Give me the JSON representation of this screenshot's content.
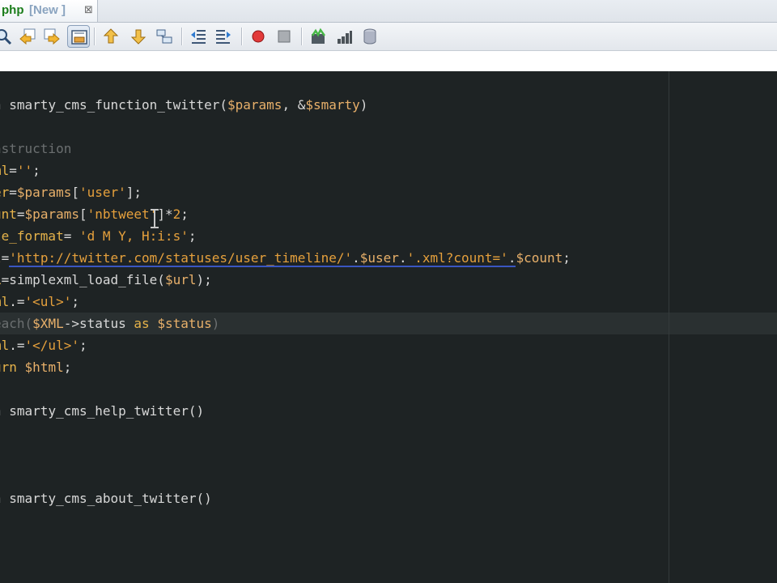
{
  "tab": {
    "file_label": "php",
    "status_badge": "[New ]",
    "close_glyph": "⊠"
  },
  "toolbar": {
    "icons": [
      "find-icon",
      "back-icon",
      "forward-icon",
      "toggle-view-icon",
      "up-icon",
      "down-icon",
      "breadcrumb-icon",
      "shift-left-icon",
      "shift-right-icon",
      "record-macro-icon",
      "stop-macro-icon",
      "bookmark-icon",
      "chart-icon",
      "database-icon"
    ],
    "active": "toggle-view-icon"
  },
  "colors": {
    "editor_bg": "#1e2324",
    "keyword": "#e6b34a",
    "string": "#e5a03c",
    "comment": "#6b6f70",
    "text": "#d8d8d8",
    "url_underline": "#3a56c2"
  },
  "code": {
    "line_1": {
      "a": "n",
      "b": " smarty_cms_function_twitter(",
      "c": "$params",
      "d": ", &",
      "e": "$smarty",
      "f": ")"
    },
    "line_2": {
      "a": "nstruction"
    },
    "line_3": {
      "a": "ml",
      "b": "=",
      "c": "''",
      "d": ";"
    },
    "line_4": {
      "a": "er",
      "b": "=",
      "c": "$params",
      "d": "[",
      "e": "'user'",
      "f": "];"
    },
    "line_5": {
      "a": "unt",
      "b": "=",
      "c": "$params",
      "d": "[",
      "e": "'nbtweet'",
      "f": "]*",
      "g": "2",
      "h": ";"
    },
    "line_6": {
      "a": "te_format",
      "b": "= ",
      "c": "'d M Y, H:i:s'",
      "d": ";"
    },
    "line_7": {
      "a": "l",
      "b": "=",
      "c": "'http://twitter.com/statuses/user_timeline/'",
      "d": ".",
      "e": "$user",
      "f": ".",
      "g": "'.xml?count='",
      "h": ".",
      "i": "$count",
      "j": ";"
    },
    "line_8": {
      "a": "L",
      "b": "=simplexml_load_file(",
      "c": "$url",
      "d": ");"
    },
    "line_9": {
      "a": "ml",
      "b": ".=",
      "c": "'<ul>'",
      "d": ";"
    },
    "line_10": {
      "a": "each",
      "b": "(",
      "c": "$XML",
      "d": "->status ",
      "e": "as",
      "f": " ",
      "g": "$status",
      "h": ")"
    },
    "line_11": {
      "a": "ml",
      "b": ".=",
      "c": "'</ul>'",
      "d": ";"
    },
    "line_12": {
      "a": "urn",
      "b": " ",
      "c": "$html",
      "d": ";"
    },
    "line_13": {
      "a": "n",
      "b": " smarty_cms_help_twitter()"
    },
    "line_14": {
      "a": "n",
      "b": " smarty_cms_about_twitter()"
    }
  }
}
